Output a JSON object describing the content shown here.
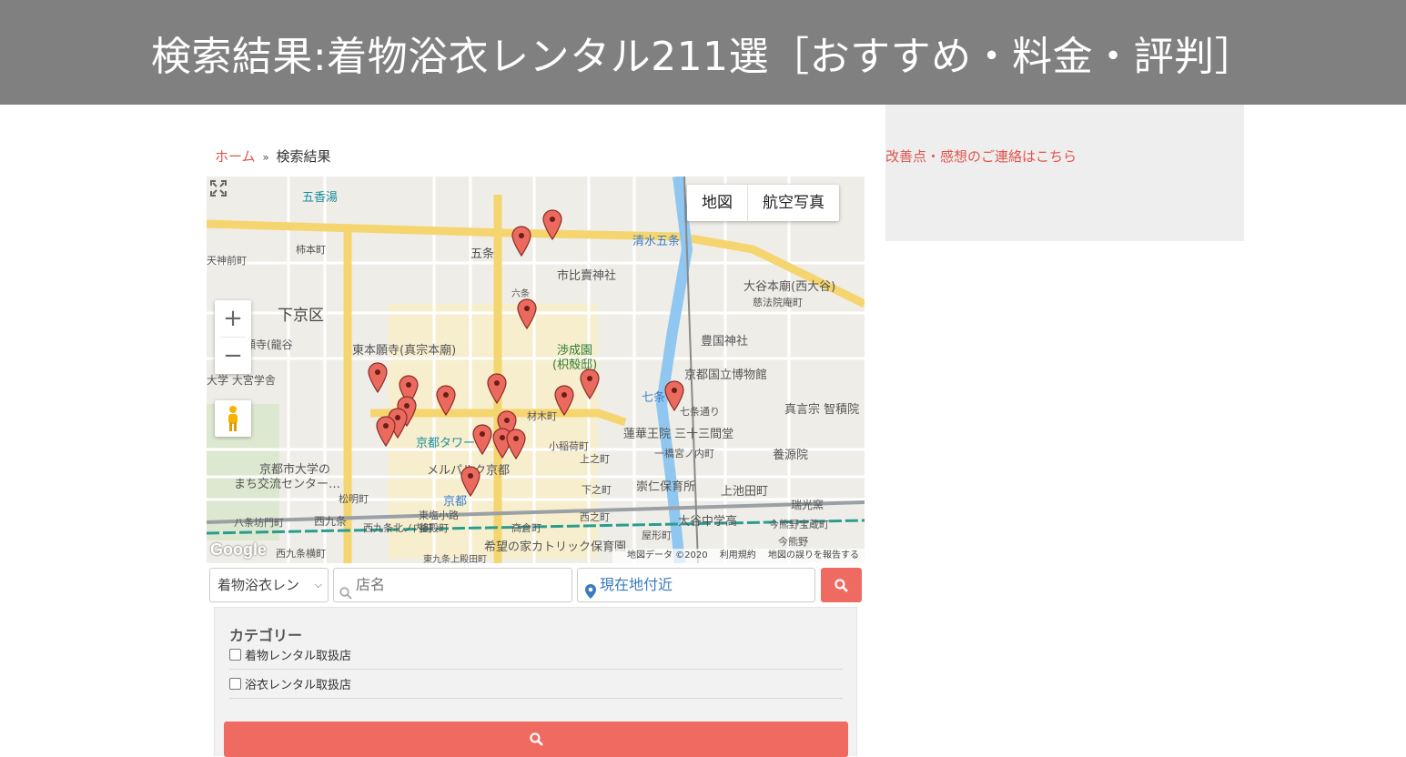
{
  "header": {
    "title": "検索結果:着物浴衣レンタル211選［おすすめ・料金・評判］"
  },
  "breadcrumb": {
    "home": "ホーム",
    "separator": "»",
    "current": "検索結果"
  },
  "sidebar": {
    "feedback_link": "改善点・感想のご連絡はこちら"
  },
  "map": {
    "type_buttons": {
      "map": "地図",
      "satellite": "航空写真"
    },
    "zoom_in": "+",
    "zoom_out": "−",
    "google_logo": "Google",
    "attribution": {
      "data": "地図データ ©2020",
      "terms": "利用規約",
      "report": "地図の誤りを報告する"
    },
    "labels": {
      "gojoyu": "五香湯",
      "gojo": "五条",
      "shimizu_gojo": "清水五条",
      "ichihime": "市比賣神社",
      "shimogyo": "下京区",
      "higashi_honganji": "東本願寺(真宗本廟)",
      "otani_honbyo": "大谷本廟(西大谷)",
      "jihoin": "慈法院庵町",
      "toyokuni": "豊国神社",
      "shoseien": "渉成園",
      "kikokutei": "(枳殻邸)",
      "museum": "京都国立博物館",
      "shichijo": "七条",
      "shichijo_dori": "七条通り",
      "chishakuin": "真言宗 智積院",
      "rengeoin": "蓮華王院 三十三間堂",
      "kyoto_tower": "京都タワー",
      "yogenin": "養源院",
      "ichihashi": "一橋宮ノ内町",
      "metropolis": "メルパルク京都",
      "machikoryu": "まち交流センター…",
      "kyoto_univ": "京都市大学の",
      "kyoto_station": "京都",
      "suujin": "崇仁保育所",
      "kamiikeda": "上池田町",
      "zuikoku": "瑞光窯",
      "otani_chu": "大谷中学高",
      "imakumano": "今熊野宝蔵町",
      "nishi_kujo": "西九条",
      "kibou": "希望の家カトリック保育園",
      "hattabo": "八条坊門町",
      "daigaku": "大学 大宮学舎",
      "ryukoku": "本願寺(龍谷",
      "sakamoto": "柿本町",
      "zaimoku": "材木町",
      "koinari": "小稲荷町",
      "kamiyanagi": "上之町",
      "shimonocho": "下之町",
      "shorinji": "松明町",
      "higashi_shiokoji": "東塩小路",
      "kamazacho": "釜殿町",
      "takakura": "高倉町",
      "nishikujo_b": "西九条北ノ内町",
      "yashiro": "屋形町",
      "imakumano2": "今熊野",
      "nishi_nocho": "西之町",
      "tenjin": "天神前町",
      "kuyo": "西九条横町",
      "rokujo": "六条",
      "kuzuo": "東九条上殿田町"
    }
  },
  "search": {
    "category_value": "着物浴衣レン",
    "name_placeholder": "店名",
    "location_value": "現在地付近"
  },
  "filters": {
    "title": "カテゴリー",
    "options": [
      {
        "label": "着物レンタル取扱店",
        "checked": false
      },
      {
        "label": "浴衣レンタル取扱店",
        "checked": false
      }
    ]
  },
  "colors": {
    "header_bg": "#808080",
    "accent": "#ef6b61",
    "link": "#e0544c",
    "pin": "#ea6a5f"
  },
  "icons": {
    "fullscreen": "fullscreen-icon",
    "pegman": "pegman-icon",
    "search": "search-icon",
    "pin": "map-pin-icon",
    "location": "location-pin-icon",
    "dropdown": "chevron-down-icon"
  }
}
